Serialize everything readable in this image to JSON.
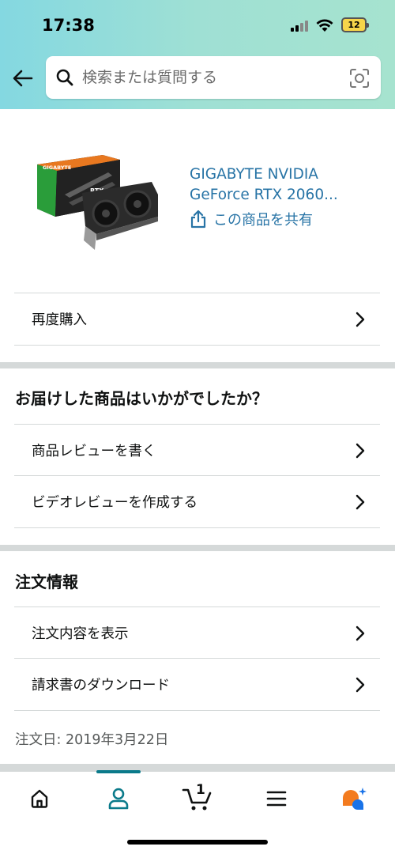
{
  "status": {
    "time": "17:38",
    "battery": "12"
  },
  "search": {
    "placeholder": "検索または質問する"
  },
  "product": {
    "title": "GIGABYTE NVIDIA GeForce RTX 2060...",
    "share_label": "この商品を共有",
    "box_brand": "GIGABYTE",
    "box_model": "RTX"
  },
  "rows": {
    "buy_again": "再度購入"
  },
  "review_section": {
    "title": "お届けした商品はいかがでしたか？",
    "write_review": "商品レビューを書く",
    "video_review": "ビデオレビューを作成する"
  },
  "order_section": {
    "title": "注文情報",
    "view_order": "注文内容を表示",
    "download_invoice": "請求書のダウンロード",
    "order_date": "注文日: 2019年3月22日"
  },
  "nav": {
    "items": [
      "home-icon",
      "account-icon",
      "cart-icon",
      "menu-icon",
      "ai-assistant-icon"
    ],
    "cart_count": "1",
    "active": "account",
    "accent": "#0a7a8a"
  },
  "colors": {
    "link": "#2874a6",
    "header_start": "#84d8e1",
    "header_end": "#a6e3cf"
  }
}
